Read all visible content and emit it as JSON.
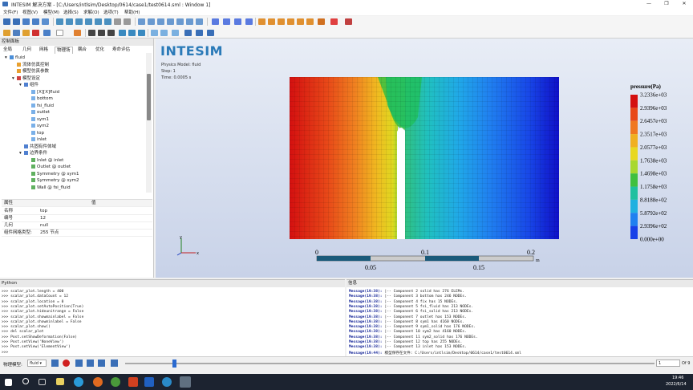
{
  "window": {
    "title": "INTESIM 解决方案 - [C:/Users/intlsim/Desktop/0614/case1/test0614.sml : Window 1]",
    "minimize_icon": "minimize-icon",
    "maximize_icon": "restore-icon",
    "close_icon": "close-icon"
  },
  "menu": [
    "文件(F)",
    "视图(V)",
    "模型(M)",
    "选择(S)",
    "求解(O)",
    "选项(T)",
    "帮助(H)"
  ],
  "left_panel": {
    "title": "控制面板",
    "tabs": [
      "全局",
      "几何",
      "网格",
      "物理场",
      "耦合",
      "优化",
      "寿命评估"
    ],
    "active_tab": "物理场",
    "tree": [
      {
        "label": "fluid",
        "level": 0,
        "expand": "▾",
        "icon": "#4a8ed8"
      },
      {
        "label": "流体仿真控制",
        "level": 1,
        "expand": "",
        "icon": "#e8a030"
      },
      {
        "label": "模型仿真参数",
        "level": 1,
        "expand": "",
        "icon": "#e8a030"
      },
      {
        "label": "模型设定",
        "level": 1,
        "expand": "▾",
        "icon": "#d04040"
      },
      {
        "label": "组件",
        "level": 2,
        "expand": "▾",
        "icon": "#5080d0"
      },
      {
        "label": "[X][X]fluid",
        "level": 3,
        "expand": "",
        "icon": "#7ab0e8"
      },
      {
        "label": "bottom",
        "level": 3,
        "expand": "",
        "icon": "#7ab0e8"
      },
      {
        "label": "fsi_fluid",
        "level": 3,
        "expand": "",
        "icon": "#7ab0e8"
      },
      {
        "label": "outlet",
        "level": 3,
        "expand": "",
        "icon": "#7ab0e8"
      },
      {
        "label": "sym1",
        "level": 3,
        "expand": "",
        "icon": "#7ab0e8"
      },
      {
        "label": "sym2",
        "level": 3,
        "expand": "",
        "icon": "#7ab0e8"
      },
      {
        "label": "top",
        "level": 3,
        "expand": "",
        "icon": "#7ab0e8"
      },
      {
        "label": "inlet",
        "level": 3,
        "expand": "",
        "icon": "#7ab0e8"
      },
      {
        "label": "共固有件体域",
        "level": 2,
        "expand": "",
        "icon": "#5080d0"
      },
      {
        "label": "边界条件",
        "level": 2,
        "expand": "▾",
        "icon": "#5080d0"
      },
      {
        "label": "Inlet @ inlet",
        "level": 3,
        "expand": "",
        "icon": "#60b060"
      },
      {
        "label": "Outlet @ outlet",
        "level": 3,
        "expand": "",
        "icon": "#60b060"
      },
      {
        "label": "Symmetry @ sym1",
        "level": 3,
        "expand": "",
        "icon": "#60b060"
      },
      {
        "label": "Symmetry @ sym2",
        "level": 3,
        "expand": "",
        "icon": "#60b060"
      },
      {
        "label": "Wall @ fsi_fluid",
        "level": 3,
        "expand": "",
        "icon": "#60b060"
      }
    ],
    "properties": {
      "header": [
        "属性",
        "值"
      ],
      "rows": [
        [
          "名称",
          "top"
        ],
        [
          "编号",
          "12"
        ],
        [
          "几何",
          "null"
        ],
        [
          "组件网格类型:",
          "255 节点"
        ]
      ]
    }
  },
  "viewport": {
    "logo": "INTESIM",
    "physics_model": "Physics Model: fluid",
    "step": "Step: 1",
    "time": "Time: 0.0005 s",
    "legend_title": "pressure(Pa)",
    "legend_values": [
      "3.2336e+03",
      "2.9396e+03",
      "2.6457e+03",
      "2.3517e+03",
      "2.0577e+03",
      "1.7638e+03",
      "1.4698e+03",
      "1.1758e+03",
      "8.8188e+02",
      "5.8792e+02",
      "2.9396e+02",
      "0.000e+00"
    ],
    "legend_colors": [
      "#d41010",
      "#e84818",
      "#f07820",
      "#f0b020",
      "#e8d820",
      "#a8d830",
      "#40c040",
      "#20c0a0",
      "#20b0e0",
      "#2080f0",
      "#1840e8",
      "#1010c8"
    ],
    "scale_top": [
      "0",
      "0.1",
      "0.2"
    ],
    "scale_bottom": [
      "0.05",
      "0.15"
    ],
    "scale_unit": "m",
    "axis_y": "y",
    "axis_x": "x"
  },
  "python_panel": {
    "title": "Python",
    "lines": [
      ">>> scalar_plot.length = 400",
      ">>> scalar_plot.dataCount = 12",
      ">>> scalar_plot.location = 0",
      ">>> scalar_plot.setAutoPosition(True)",
      ">>> scalar_plot.hideunitrange = False",
      ">>> scalar_plot.showmainlabel = False",
      ">>> scalar_plot.showminlabel = False",
      ">>> scalar_plot.show()",
      ">>> del scalar_plot",
      ">>> Post.setShowDeformation(False)",
      ">>> Post.setView('NoneView')",
      ">>> Post.setView('ElementView')",
      ">>>"
    ]
  },
  "info_panel": {
    "title": "信息",
    "lines": [
      [
        "Message(19:38):",
        "|-- Component 2 solid has 276 ELEMs."
      ],
      [
        "Message(19:38):",
        "|-- Component 3 bottom has 246 NODEs."
      ],
      [
        "Message(19:38):",
        "|-- Component 4 fix has 15 NODEs."
      ],
      [
        "Message(19:38):",
        "|-- Component 5 fsi_fluid has 213 NODEs."
      ],
      [
        "Message(19:38):",
        "|-- Component 6 fsi_solid has 213 NODEs."
      ],
      [
        "Message(19:38):",
        "|-- Component 7 outlet has 153 NODEs."
      ],
      [
        "Message(19:38):",
        "|-- Component 8 sym1 has 4160 NODEs."
      ],
      [
        "Message(19:38):",
        "|-- Component 9 sym1_solid has 176 NODEs."
      ],
      [
        "Message(19:38):",
        "|-- Component 10 sym2 has 4160 NODEs."
      ],
      [
        "Message(19:38):",
        "|-- Component 11 sym2_solid has 176 NODEs."
      ],
      [
        "Message(19:38):",
        "|-- Component 12 top has 255 NODEs."
      ],
      [
        "Message(19:38):",
        "|-- Component 13 inlet has 153 NODEs."
      ],
      [
        "Message(19:44):",
        "模型保存在文件: C:/Users/intlsim/Desktop/0614/case1/test0614.sml"
      ]
    ]
  },
  "anim_bar": {
    "label": "物理模型:",
    "model_select": "fluid",
    "frame_input": "1",
    "frame_total": "Of 9",
    "slider_position": 0.09
  },
  "taskbar": {
    "time": "19:46",
    "date": "2022/6/14"
  }
}
